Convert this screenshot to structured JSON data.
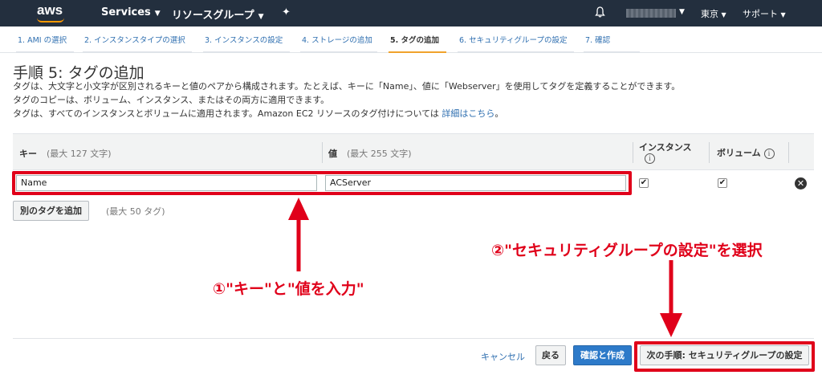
{
  "topnav": {
    "logo": "aws",
    "services": "Services",
    "resource_groups": "リソースグループ",
    "region": "東京",
    "support": "サポート"
  },
  "steps": [
    {
      "label": "1. AMI の選択",
      "active": false
    },
    {
      "label": "2. インスタンスタイプの選択",
      "active": false
    },
    {
      "label": "3. インスタンスの設定",
      "active": false
    },
    {
      "label": "4. ストレージの追加",
      "active": false
    },
    {
      "label": "5. タグの追加",
      "active": true
    },
    {
      "label": "6. セキュリティグループの設定",
      "active": false
    },
    {
      "label": "7. 確認",
      "active": false
    }
  ],
  "page": {
    "title": "手順 5: タグの追加",
    "desc1": "タグは、大文字と小文字が区別されるキーと値のペアから構成されます。たとえば、キーに「Name」、値に「Webserver」を使用してタグを定義することができます。",
    "desc2": "タグのコピーは、ボリューム、インスタンス、またはその両方に適用できます。",
    "desc3": "タグは、すべてのインスタンスとボリュームに適用されます。Amazon EC2 リソースのタグ付けについては",
    "desc3_link": "詳細はこちら",
    "desc3_end": "。"
  },
  "table": {
    "key_header": "キー",
    "key_hint": "(最大 127 文字)",
    "value_header": "値",
    "value_hint": "(最大 255 文字)",
    "instances_header": "インスタンス",
    "volumes_header": "ボリューム",
    "info": "i",
    "row": {
      "key": "Name",
      "value": "ACServer",
      "instances": true,
      "volumes": true
    }
  },
  "add_tag": {
    "button": "別のタグを追加",
    "hint": "(最大 50 タグ)"
  },
  "footer": {
    "cancel": "キャンセル",
    "back": "戻る",
    "review_launch": "確認と作成",
    "next": "次の手順: セキュリティグループの設定"
  },
  "annotations": {
    "step1": "①\"キー\"と\"値を入力\"",
    "step2": "②\"セキュリティグループの設定\"を選択"
  },
  "colors": {
    "nav_bg": "#232f3e",
    "accent_orange": "#f0a32c",
    "link_blue": "#2f6fb0",
    "primary_button": "#2d7ac9",
    "annotation_red": "#e0001a"
  }
}
